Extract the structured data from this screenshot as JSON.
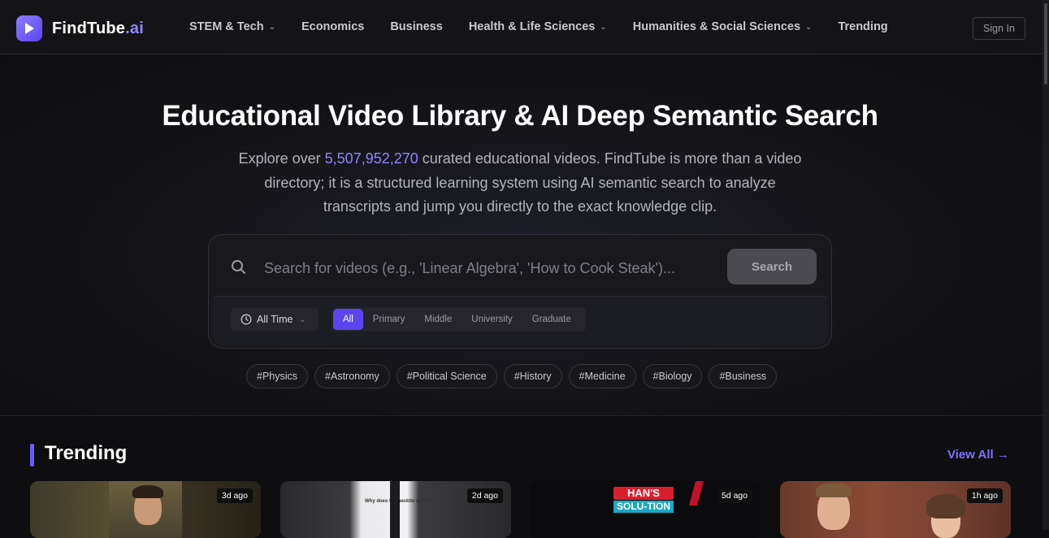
{
  "brand": {
    "name": "FindTube",
    "suffix": ".ai",
    "accent": "#8f86ff",
    "logo_icon": "play-icon"
  },
  "nav": {
    "links": [
      {
        "label": "STEM & Tech",
        "has_dropdown": true
      },
      {
        "label": "Economics",
        "has_dropdown": false
      },
      {
        "label": "Business",
        "has_dropdown": false
      },
      {
        "label": "Health & Life Sciences",
        "has_dropdown": true
      },
      {
        "label": "Humanities & Social Sciences",
        "has_dropdown": true
      },
      {
        "label": "Trending",
        "has_dropdown": false
      }
    ],
    "sign_in": "Sign In"
  },
  "hero": {
    "title": "Educational Video Library & AI Deep Semantic Search",
    "subtitle_prefix": "Explore over ",
    "video_count": "5,507,952,270",
    "subtitle_suffix": " curated educational videos. FindTube is more than a video directory; it is a structured learning system using AI semantic search to analyze transcripts and jump you directly to the exact knowledge clip."
  },
  "search": {
    "placeholder": "Search for videos (e.g., 'Linear Algebra', 'How to Cook Steak')...",
    "value": "",
    "button": "Search",
    "time_filter": "All Time",
    "levels": [
      "All",
      "Primary",
      "Middle",
      "University",
      "Graduate"
    ],
    "active_level": "All"
  },
  "tags": [
    "#Physics",
    "#Astronomy",
    "#Political Science",
    "#History",
    "#Medicine",
    "#Biology",
    "#Business"
  ],
  "trending": {
    "title": "Trending",
    "view_all": "View All",
    "view_all_arrow": "→",
    "cards": [
      {
        "age": "3d ago"
      },
      {
        "age": "2d ago",
        "thumb_text": "Why does the necktie exist?"
      },
      {
        "age": "5d ago",
        "thumb_text_top": "HAN'S",
        "thumb_text_bottom": "SOLU-TION"
      },
      {
        "age": "1h ago"
      }
    ]
  }
}
